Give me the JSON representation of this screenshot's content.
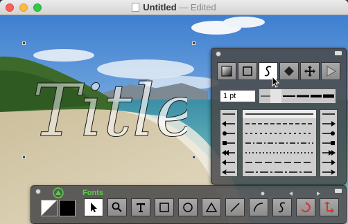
{
  "window": {
    "title": "Untitled",
    "title_suffix": "— Edited"
  },
  "canvas": {
    "text_object": "Title"
  },
  "stroke_panel": {
    "tools": [
      "gradient-fill",
      "rectangle",
      "freehand",
      "fill",
      "move",
      "play"
    ],
    "active_tool": "freehand",
    "line_width": "1 pt"
  },
  "main_toolbar": {
    "fonts_label": "Fonts",
    "tools": [
      "pointer",
      "zoom",
      "text",
      "rectangle",
      "oval",
      "triangle",
      "line",
      "arc",
      "freehand",
      "rotate",
      "transform"
    ],
    "active_tool": "pointer",
    "fill_color": "#ffffff",
    "stroke_color": "#000000",
    "accent_color": "#57d247"
  }
}
